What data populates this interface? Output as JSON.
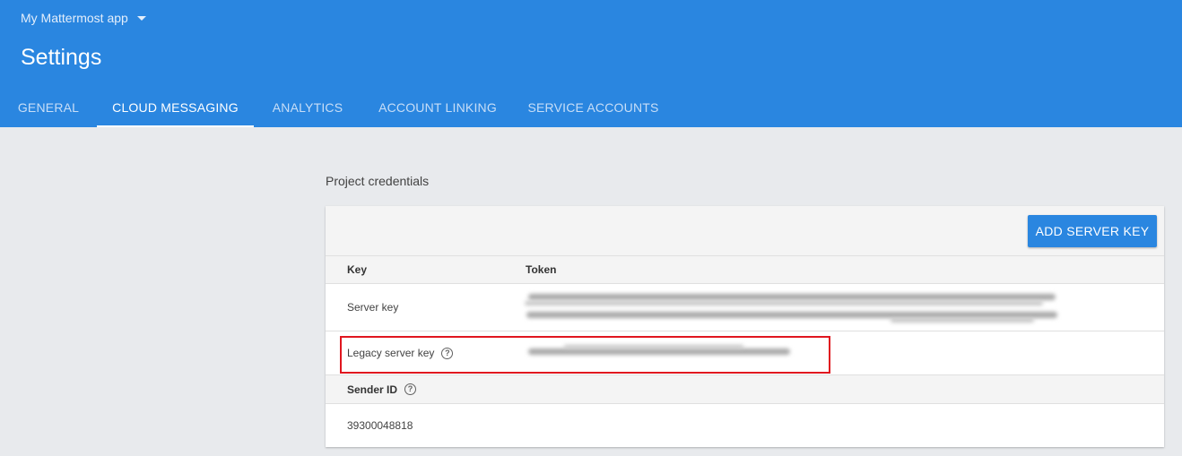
{
  "header": {
    "app_name": "My Mattermost app",
    "title": "Settings",
    "tabs": [
      {
        "label": "GENERAL"
      },
      {
        "label": "CLOUD MESSAGING"
      },
      {
        "label": "ANALYTICS"
      },
      {
        "label": "ACCOUNT LINKING"
      },
      {
        "label": "SERVICE ACCOUNTS"
      }
    ],
    "active_tab": "CLOUD MESSAGING"
  },
  "credentials": {
    "section_title": "Project credentials",
    "add_button_label": "ADD SERVER KEY",
    "columns": {
      "key": "Key",
      "token": "Token"
    },
    "rows": [
      {
        "key": "Server key",
        "token_redacted": true
      },
      {
        "key": "Legacy server key",
        "token_redacted": true,
        "help_icon": "help-circle-icon",
        "highlighted": true
      }
    ],
    "sender_id_label": "Sender ID",
    "sender_id_help_icon": "help-circle-icon",
    "sender_id_value": "39300048818"
  },
  "colors": {
    "header_bg": "#2a86e0",
    "button_bg": "#2a86e0",
    "highlight_border": "#e0161f",
    "page_bg": "#e8eaed"
  }
}
